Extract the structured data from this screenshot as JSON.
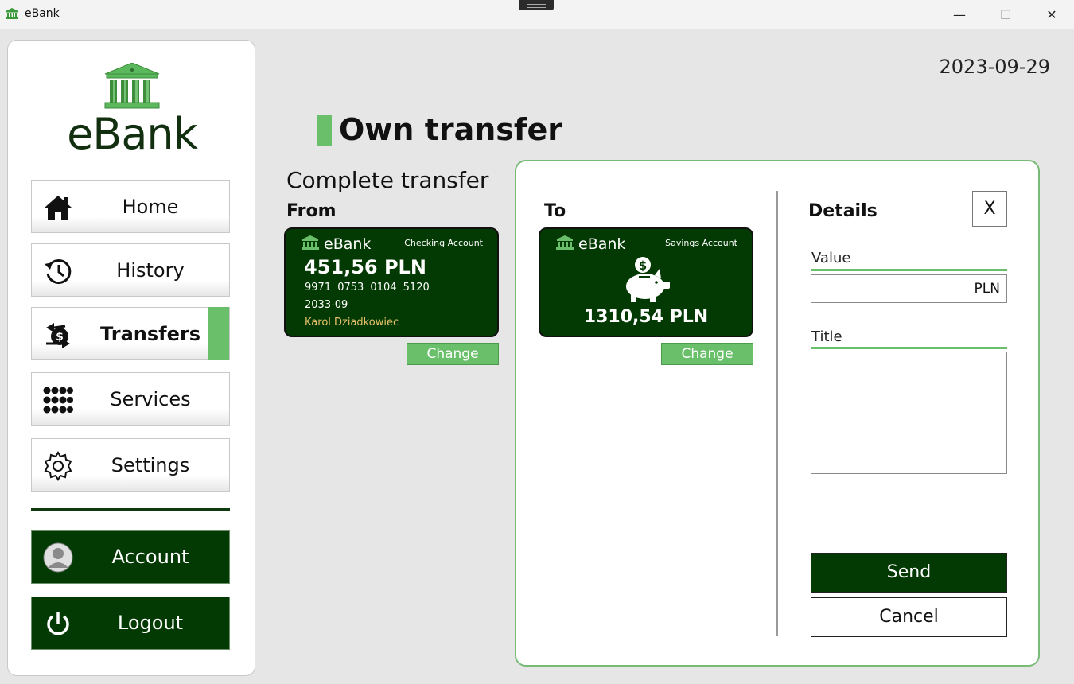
{
  "window": {
    "title": "eBank",
    "minimize_label": "—",
    "maximize_label": "☐",
    "close_label": "✕"
  },
  "sidebar": {
    "logo_text": "eBank",
    "items": [
      {
        "label": "Home",
        "icon": "home-icon"
      },
      {
        "label": "History",
        "icon": "history-icon"
      },
      {
        "label": "Transfers",
        "icon": "transfers-icon",
        "active": true
      },
      {
        "label": "Services",
        "icon": "services-grid-icon"
      },
      {
        "label": "Settings",
        "icon": "gear-icon"
      }
    ],
    "account_label": "Account",
    "logout_label": "Logout"
  },
  "header": {
    "date": "2023-09-29",
    "title": "Own transfer"
  },
  "transfer": {
    "subtitle": "Complete transfer",
    "from_label": "From",
    "to_label": "To",
    "from_card": {
      "brand": "eBank",
      "type": "Checking Account",
      "balance": "451,56 PLN",
      "number": "9971 0753 0104 5120",
      "expiry": "2033-09",
      "owner": "Karol Dziadkowiec"
    },
    "to_card": {
      "brand": "eBank",
      "type": "Savings Account",
      "balance": "1310,54 PLN",
      "icon": "piggy-bank-icon"
    },
    "change_label": "Change"
  },
  "details": {
    "label": "Details",
    "close_label": "X",
    "value_label": "Value",
    "value": "",
    "currency": "PLN",
    "title_label": "Title",
    "title_value": "",
    "send_label": "Send",
    "cancel_label": "Cancel"
  },
  "colors": {
    "accent": "#6abf6a",
    "dark_green": "#033a03",
    "background": "#e6e6e6"
  }
}
